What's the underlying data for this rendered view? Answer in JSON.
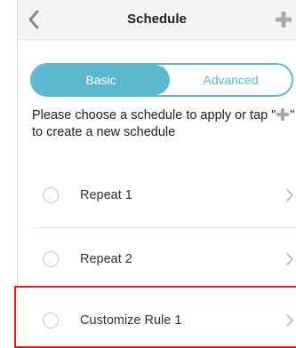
{
  "header": {
    "title": "Schedule",
    "back_icon": "chevron-left-icon",
    "add_icon": "plus-icon"
  },
  "segment": {
    "basic_label": "Basic",
    "advanced_label": "Advanced",
    "selected": "Basic",
    "accent_color": "#5bb8cf"
  },
  "description": {
    "before": "Please choose a schedule to apply or tap \"",
    "after": "\" to create a new schedule"
  },
  "schedules": [
    {
      "label": "Repeat 1"
    },
    {
      "label": "Repeat 2"
    },
    {
      "label": "Customize Rule 1"
    }
  ],
  "highlight_color": "#e02020"
}
